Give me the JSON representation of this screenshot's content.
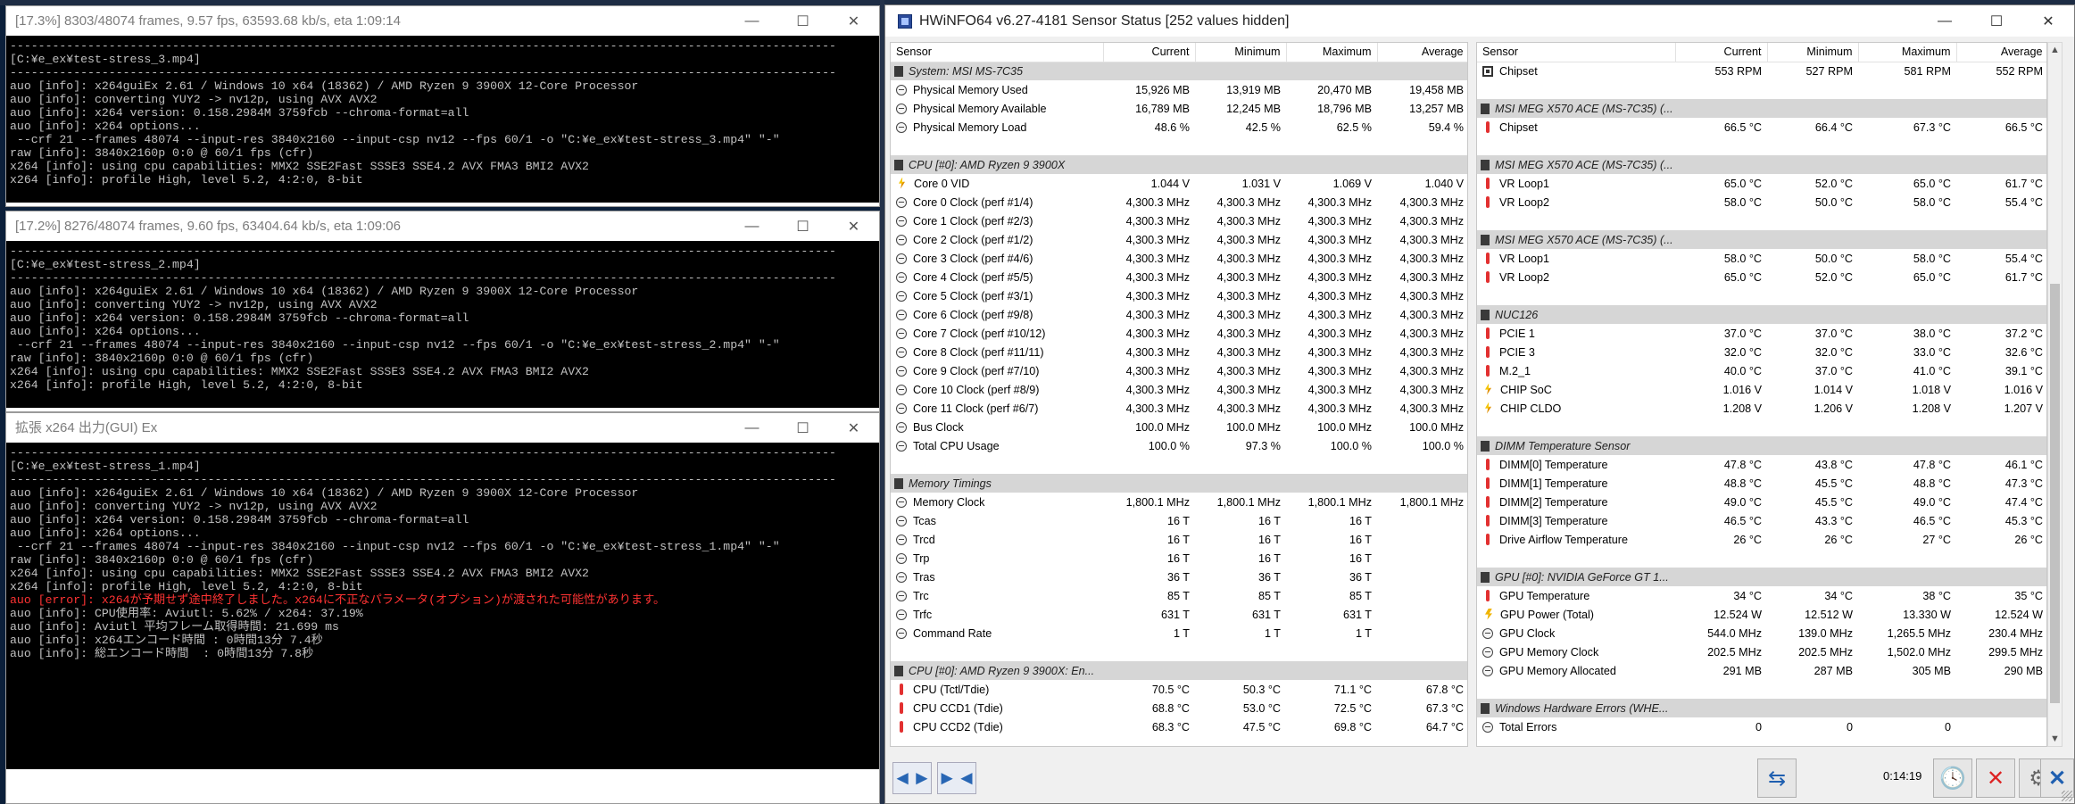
{
  "console_windows": [
    {
      "title": "[17.3%] 8303/48074 frames, 9.57 fps, 63593.68 kb/s, eta 1:09:14",
      "lines": [
        {
          "t": "---------------------------------------------------------------------------------------------------------------------",
          "c": "sep"
        },
        {
          "t": "[C:¥e_ex¥test-stress_3.mp4]",
          "c": ""
        },
        {
          "t": "---------------------------------------------------------------------------------------------------------------------",
          "c": "sep"
        },
        {
          "t": "auo [info]: x264guiEx 2.61 / Windows 10 x64 (18362) / AMD Ryzen 9 3900X 12-Core Processor",
          "c": ""
        },
        {
          "t": "auo [info]: converting YUY2 -> nv12p, using AVX AVX2",
          "c": ""
        },
        {
          "t": "auo [info]: x264 version: 0.158.2984M 3759fcb --chroma-format=all",
          "c": ""
        },
        {
          "t": "auo [info]: x264 options...",
          "c": ""
        },
        {
          "t": " --crf 21 --frames 48074 --input-res 3840x2160 --input-csp nv12 --fps 60/1 -o \"C:¥e_ex¥test-stress_3.mp4\" \"-\"",
          "c": ""
        },
        {
          "t": "raw [info]: 3840x2160p 0:0 @ 60/1 fps (cfr)",
          "c": ""
        },
        {
          "t": "x264 [info]: using cpu capabilities: MMX2 SSE2Fast SSSE3 SSE4.2 AVX FMA3 BMI2 AVX2",
          "c": ""
        },
        {
          "t": "x264 [info]: profile High, level 5.2, 4:2:0, 8-bit",
          "c": ""
        }
      ]
    },
    {
      "title": "[17.2%] 8276/48074 frames, 9.60 fps, 63404.64 kb/s, eta 1:09:06",
      "lines": [
        {
          "t": "---------------------------------------------------------------------------------------------------------------------",
          "c": "sep"
        },
        {
          "t": "[C:¥e_ex¥test-stress_2.mp4]",
          "c": ""
        },
        {
          "t": "---------------------------------------------------------------------------------------------------------------------",
          "c": "sep"
        },
        {
          "t": "auo [info]: x264guiEx 2.61 / Windows 10 x64 (18362) / AMD Ryzen 9 3900X 12-Core Processor",
          "c": ""
        },
        {
          "t": "auo [info]: converting YUY2 -> nv12p, using AVX AVX2",
          "c": ""
        },
        {
          "t": "auo [info]: x264 version: 0.158.2984M 3759fcb --chroma-format=all",
          "c": ""
        },
        {
          "t": "auo [info]: x264 options...",
          "c": ""
        },
        {
          "t": " --crf 21 --frames 48074 --input-res 3840x2160 --input-csp nv12 --fps 60/1 -o \"C:¥e_ex¥test-stress_2.mp4\" \"-\"",
          "c": ""
        },
        {
          "t": "raw [info]: 3840x2160p 0:0 @ 60/1 fps (cfr)",
          "c": ""
        },
        {
          "t": "x264 [info]: using cpu capabilities: MMX2 SSE2Fast SSSE3 SSE4.2 AVX FMA3 BMI2 AVX2",
          "c": ""
        },
        {
          "t": "x264 [info]: profile High, level 5.2, 4:2:0, 8-bit",
          "c": ""
        }
      ]
    },
    {
      "title": "拡張 x264 出力(GUI) Ex",
      "lines": [
        {
          "t": "---------------------------------------------------------------------------------------------------------------------",
          "c": "sep"
        },
        {
          "t": "[C:¥e_ex¥test-stress_1.mp4]",
          "c": ""
        },
        {
          "t": "---------------------------------------------------------------------------------------------------------------------",
          "c": "sep"
        },
        {
          "t": "auo [info]: x264guiEx 2.61 / Windows 10 x64 (18362) / AMD Ryzen 9 3900X 12-Core Processor",
          "c": ""
        },
        {
          "t": "auo [info]: converting YUY2 -> nv12p, using AVX AVX2",
          "c": ""
        },
        {
          "t": "auo [info]: x264 version: 0.158.2984M 3759fcb --chroma-format=all",
          "c": ""
        },
        {
          "t": "auo [info]: x264 options...",
          "c": ""
        },
        {
          "t": " --crf 21 --frames 48074 --input-res 3840x2160 --input-csp nv12 --fps 60/1 -o \"C:¥e_ex¥test-stress_1.mp4\" \"-\"",
          "c": ""
        },
        {
          "t": "raw [info]: 3840x2160p 0:0 @ 60/1 fps (cfr)",
          "c": ""
        },
        {
          "t": "x264 [info]: using cpu capabilities: MMX2 SSE2Fast SSSE3 SSE4.2 AVX FMA3 BMI2 AVX2",
          "c": ""
        },
        {
          "t": "x264 [info]: profile High, level 5.2, 4:2:0, 8-bit",
          "c": ""
        },
        {
          "t": "auo [error]: x264が予期せず途中終了しました。x264に不正なパラメータ(オプション)が渡された可能性があります。",
          "c": "err"
        },
        {
          "t": "auo [info]: CPU使用率: Aviutl: 5.62% / x264: 37.19%",
          "c": ""
        },
        {
          "t": "auo [info]: Aviutl 平均フレーム取得時間: 21.699 ms",
          "c": ""
        },
        {
          "t": "auo [info]: x264エンコード時間 : 0時間13分 7.4秒",
          "c": ""
        },
        {
          "t": "auo [info]: 総エンコード時間  : 0時間13分 7.8秒",
          "c": ""
        }
      ]
    }
  ],
  "window_controls": {
    "minimize": "—",
    "maximize": "☐",
    "close": "✕"
  },
  "hwinfo": {
    "title": "HWiNFO64 v6.27-4181 Sensor Status [252 values hidden]",
    "columns": [
      "Sensor",
      "Current",
      "Minimum",
      "Maximum",
      "Average"
    ],
    "left": [
      {
        "g": "System: MSI MS-7C35"
      },
      {
        "i": "clock",
        "n": "Physical Memory Used",
        "v": [
          "15,926 MB",
          "13,919 MB",
          "20,470 MB",
          "19,458 MB"
        ]
      },
      {
        "i": "clock",
        "n": "Physical Memory Available",
        "v": [
          "16,789 MB",
          "12,245 MB",
          "18,796 MB",
          "13,257 MB"
        ]
      },
      {
        "i": "clock",
        "n": "Physical Memory Load",
        "v": [
          "48.6 %",
          "42.5 %",
          "62.5 %",
          "59.4 %"
        ]
      },
      {
        "b": 1
      },
      {
        "g": "CPU [#0]: AMD Ryzen 9 3900X"
      },
      {
        "i": "volt",
        "n": "Core 0 VID",
        "v": [
          "1.044 V",
          "1.031 V",
          "1.069 V",
          "1.040 V"
        ]
      },
      {
        "i": "clock",
        "n": "Core 0 Clock (perf #1/4)",
        "v": [
          "4,300.3 MHz",
          "4,300.3 MHz",
          "4,300.3 MHz",
          "4,300.3 MHz"
        ]
      },
      {
        "i": "clock",
        "n": "Core 1 Clock (perf #2/3)",
        "v": [
          "4,300.3 MHz",
          "4,300.3 MHz",
          "4,300.3 MHz",
          "4,300.3 MHz"
        ]
      },
      {
        "i": "clock",
        "n": "Core 2 Clock (perf #1/2)",
        "v": [
          "4,300.3 MHz",
          "4,300.3 MHz",
          "4,300.3 MHz",
          "4,300.3 MHz"
        ]
      },
      {
        "i": "clock",
        "n": "Core 3 Clock (perf #4/6)",
        "v": [
          "4,300.3 MHz",
          "4,300.3 MHz",
          "4,300.3 MHz",
          "4,300.3 MHz"
        ]
      },
      {
        "i": "clock",
        "n": "Core 4 Clock (perf #5/5)",
        "v": [
          "4,300.3 MHz",
          "4,300.3 MHz",
          "4,300.3 MHz",
          "4,300.3 MHz"
        ]
      },
      {
        "i": "clock",
        "n": "Core 5 Clock (perf #3/1)",
        "v": [
          "4,300.3 MHz",
          "4,300.3 MHz",
          "4,300.3 MHz",
          "4,300.3 MHz"
        ]
      },
      {
        "i": "clock",
        "n": "Core 6 Clock (perf #9/8)",
        "v": [
          "4,300.3 MHz",
          "4,300.3 MHz",
          "4,300.3 MHz",
          "4,300.3 MHz"
        ]
      },
      {
        "i": "clock",
        "n": "Core 7 Clock (perf #10/12)",
        "v": [
          "4,300.3 MHz",
          "4,300.3 MHz",
          "4,300.3 MHz",
          "4,300.3 MHz"
        ]
      },
      {
        "i": "clock",
        "n": "Core 8 Clock (perf #11/11)",
        "v": [
          "4,300.3 MHz",
          "4,300.3 MHz",
          "4,300.3 MHz",
          "4,300.3 MHz"
        ]
      },
      {
        "i": "clock",
        "n": "Core 9 Clock (perf #7/10)",
        "v": [
          "4,300.3 MHz",
          "4,300.3 MHz",
          "4,300.3 MHz",
          "4,300.3 MHz"
        ]
      },
      {
        "i": "clock",
        "n": "Core 10 Clock (perf #8/9)",
        "v": [
          "4,300.3 MHz",
          "4,300.3 MHz",
          "4,300.3 MHz",
          "4,300.3 MHz"
        ]
      },
      {
        "i": "clock",
        "n": "Core 11 Clock (perf #6/7)",
        "v": [
          "4,300.3 MHz",
          "4,300.3 MHz",
          "4,300.3 MHz",
          "4,300.3 MHz"
        ]
      },
      {
        "i": "clock",
        "n": "Bus Clock",
        "v": [
          "100.0 MHz",
          "100.0 MHz",
          "100.0 MHz",
          "100.0 MHz"
        ]
      },
      {
        "i": "clock",
        "n": "Total CPU Usage",
        "v": [
          "100.0 %",
          "97.3 %",
          "100.0 %",
          "100.0 %"
        ]
      },
      {
        "b": 1
      },
      {
        "g": "Memory Timings"
      },
      {
        "i": "clock",
        "n": "Memory Clock",
        "v": [
          "1,800.1 MHz",
          "1,800.1 MHz",
          "1,800.1 MHz",
          "1,800.1 MHz"
        ]
      },
      {
        "i": "clock",
        "n": "Tcas",
        "v": [
          "16 T",
          "16 T",
          "16 T",
          ""
        ]
      },
      {
        "i": "clock",
        "n": "Trcd",
        "v": [
          "16 T",
          "16 T",
          "16 T",
          ""
        ]
      },
      {
        "i": "clock",
        "n": "Trp",
        "v": [
          "16 T",
          "16 T",
          "16 T",
          ""
        ]
      },
      {
        "i": "clock",
        "n": "Tras",
        "v": [
          "36 T",
          "36 T",
          "36 T",
          ""
        ]
      },
      {
        "i": "clock",
        "n": "Trc",
        "v": [
          "85 T",
          "85 T",
          "85 T",
          ""
        ]
      },
      {
        "i": "clock",
        "n": "Trfc",
        "v": [
          "631 T",
          "631 T",
          "631 T",
          ""
        ]
      },
      {
        "i": "clock",
        "n": "Command Rate",
        "v": [
          "1 T",
          "1 T",
          "1 T",
          ""
        ]
      },
      {
        "b": 1
      },
      {
        "g": "CPU [#0]: AMD Ryzen 9 3900X: En..."
      },
      {
        "i": "temp",
        "n": "CPU (Tctl/Tdie)",
        "v": [
          "70.5 °C",
          "50.3 °C",
          "71.1 °C",
          "67.8 °C"
        ]
      },
      {
        "i": "temp",
        "n": "CPU CCD1 (Tdie)",
        "v": [
          "68.8 °C",
          "53.0 °C",
          "72.5 °C",
          "67.3 °C"
        ]
      },
      {
        "i": "temp",
        "n": "CPU CCD2 (Tdie)",
        "v": [
          "68.3 °C",
          "47.5 °C",
          "69.8 °C",
          "64.7 °C"
        ]
      }
    ],
    "right": [
      {
        "i": "chip",
        "n": "Chipset",
        "v": [
          "553 RPM",
          "527 RPM",
          "581 RPM",
          "552 RPM"
        ]
      },
      {
        "b": 1
      },
      {
        "g": "MSI MEG X570 ACE (MS-7C35) (..."
      },
      {
        "i": "temp",
        "n": "Chipset",
        "v": [
          "66.5 °C",
          "66.4 °C",
          "67.3 °C",
          "66.5 °C"
        ]
      },
      {
        "b": 1
      },
      {
        "g": "MSI MEG X570 ACE (MS-7C35) (..."
      },
      {
        "i": "temp",
        "n": "VR Loop1",
        "v": [
          "65.0 °C",
          "52.0 °C",
          "65.0 °C",
          "61.7 °C"
        ]
      },
      {
        "i": "temp",
        "n": "VR Loop2",
        "v": [
          "58.0 °C",
          "50.0 °C",
          "58.0 °C",
          "55.4 °C"
        ]
      },
      {
        "b": 1
      },
      {
        "g": "MSI MEG X570 ACE (MS-7C35) (..."
      },
      {
        "i": "temp",
        "n": "VR Loop1",
        "v": [
          "58.0 °C",
          "50.0 °C",
          "58.0 °C",
          "55.4 °C"
        ]
      },
      {
        "i": "temp",
        "n": "VR Loop2",
        "v": [
          "65.0 °C",
          "52.0 °C",
          "65.0 °C",
          "61.7 °C"
        ]
      },
      {
        "b": 1
      },
      {
        "g": "NUC126"
      },
      {
        "i": "temp",
        "n": "PCIE 1",
        "v": [
          "37.0 °C",
          "37.0 °C",
          "38.0 °C",
          "37.2 °C"
        ]
      },
      {
        "i": "temp",
        "n": "PCIE 3",
        "v": [
          "32.0 °C",
          "32.0 °C",
          "33.0 °C",
          "32.6 °C"
        ]
      },
      {
        "i": "temp",
        "n": "M.2_1",
        "v": [
          "40.0 °C",
          "37.0 °C",
          "41.0 °C",
          "39.1 °C"
        ]
      },
      {
        "i": "volt",
        "n": "CHIP SoC",
        "v": [
          "1.016 V",
          "1.014 V",
          "1.018 V",
          "1.016 V"
        ]
      },
      {
        "i": "volt",
        "n": "CHIP CLDO",
        "v": [
          "1.208 V",
          "1.206 V",
          "1.208 V",
          "1.207 V"
        ]
      },
      {
        "b": 1
      },
      {
        "g": "DIMM Temperature Sensor"
      },
      {
        "i": "temp",
        "n": "DIMM[0] Temperature",
        "v": [
          "47.8 °C",
          "43.8 °C",
          "47.8 °C",
          "46.1 °C"
        ]
      },
      {
        "i": "temp",
        "n": "DIMM[1] Temperature",
        "v": [
          "48.8 °C",
          "45.5 °C",
          "48.8 °C",
          "47.3 °C"
        ]
      },
      {
        "i": "temp",
        "n": "DIMM[2] Temperature",
        "v": [
          "49.0 °C",
          "45.5 °C",
          "49.0 °C",
          "47.4 °C"
        ]
      },
      {
        "i": "temp",
        "n": "DIMM[3] Temperature",
        "v": [
          "46.5 °C",
          "43.3 °C",
          "46.5 °C",
          "45.3 °C"
        ]
      },
      {
        "i": "temp",
        "n": "Drive Airflow Temperature",
        "v": [
          "26 °C",
          "26 °C",
          "27 °C",
          "26 °C"
        ]
      },
      {
        "b": 1
      },
      {
        "g": "GPU [#0]: NVIDIA GeForce GT 1..."
      },
      {
        "i": "temp",
        "n": "GPU Temperature",
        "v": [
          "34 °C",
          "34 °C",
          "38 °C",
          "35 °C"
        ]
      },
      {
        "i": "power",
        "n": "GPU Power (Total)",
        "v": [
          "12.524 W",
          "12.512 W",
          "13.330 W",
          "12.524 W"
        ]
      },
      {
        "i": "clock",
        "n": "GPU Clock",
        "v": [
          "544.0 MHz",
          "139.0 MHz",
          "1,265.5 MHz",
          "230.4 MHz"
        ]
      },
      {
        "i": "clock",
        "n": "GPU Memory Clock",
        "v": [
          "202.5 MHz",
          "202.5 MHz",
          "1,502.0 MHz",
          "299.5 MHz"
        ]
      },
      {
        "i": "clock",
        "n": "GPU Memory Allocated",
        "v": [
          "291 MB",
          "287 MB",
          "305 MB",
          "290 MB"
        ]
      },
      {
        "b": 1
      },
      {
        "g": "Windows Hardware Errors (WHE..."
      },
      {
        "i": "clock",
        "n": "Total Errors",
        "v": [
          "0",
          "0",
          "0",
          ""
        ]
      }
    ],
    "bottom": {
      "timer": "0:14:19",
      "nav_left": "◄►",
      "nav_right": "►◄",
      "net_icon": "⇆",
      "clock_icon": "🕓",
      "reset_icon": "✕",
      "settings_icon": "⚙",
      "close_icon": "✕"
    }
  }
}
